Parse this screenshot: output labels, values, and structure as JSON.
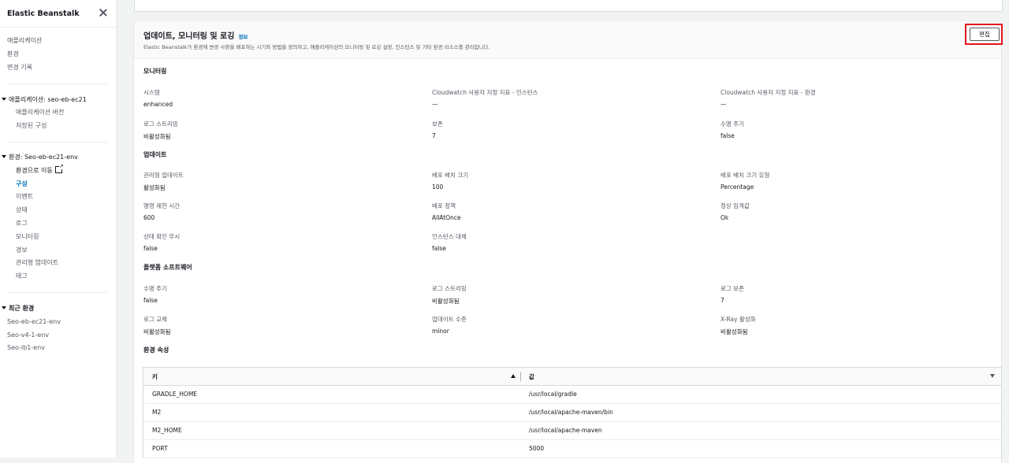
{
  "sidebar": {
    "title": "Elastic Beanstalk",
    "top_links": [
      "애플리케이션",
      "환경",
      "변경 기록"
    ],
    "app_section": "애플리케이션: seo-eb-ec21",
    "app_links": [
      "애플리케이션 버전",
      "저장된 구성"
    ],
    "env_section": "환경: Seo-eb-ec21-env",
    "env_links": [
      "환경으로 이동",
      "구성",
      "이벤트",
      "상태",
      "로그",
      "모니터링",
      "경보",
      "관리형 업데이트",
      "태그"
    ],
    "recent_section": "최근 환경",
    "recent_links": [
      "Seo-eb-ec21-env",
      "Seo-v4-1-env",
      "Seo-lb1-env"
    ]
  },
  "panel": {
    "title": "업데이트, 모니터링 및 로깅",
    "info": "정보",
    "description": "Elastic Beanstalk가 환경에 변경 사항을 배포하는 시기와 방법을 정의하고, 애플리케이션의 모니터링 및 로깅 설정, 인스턴스 및 기타 환경 리소스를 관리합니다.",
    "edit_button": "편집"
  },
  "monitoring": {
    "heading": "모니터링",
    "system_label": "시스템",
    "system_value": "enhanced",
    "cw_instance_label": "Cloudwatch 사용자 지정 지표 - 인스턴스",
    "cw_instance_value": "—",
    "cw_env_label": "Cloudwatch 사용자 지정 지표 - 환경",
    "cw_env_value": "—",
    "log_stream_label": "로그 스트리밍",
    "log_stream_value": "비활성화됨",
    "retention_label": "보존",
    "retention_value": "7",
    "lifecycle_label": "수명 주기",
    "lifecycle_value": "false"
  },
  "updates": {
    "heading": "업데이트",
    "managed_label": "관리형 업데이트",
    "managed_value": "활성화됨",
    "batch_size_label": "배포 배치 크기",
    "batch_size_value": "100",
    "batch_type_label": "배포 배치 크기 유형",
    "batch_type_value": "Percentage",
    "timeout_label": "명령 제한 시간",
    "timeout_value": "600",
    "policy_label": "배포 정책",
    "policy_value": "AllAtOnce",
    "threshold_label": "정상 임계값",
    "threshold_value": "Ok",
    "ignore_health_label": "상태 확인 무시",
    "ignore_health_value": "false",
    "replace_label": "인스턴스 대체",
    "replace_value": "false"
  },
  "platform": {
    "heading": "플랫폼 소프트웨어",
    "lifecycle_label": "수명 주기",
    "lifecycle_value": "false",
    "log_stream_label": "로그 스트리밍",
    "log_stream_value": "비활성화됨",
    "log_retention_label": "로그 보존",
    "log_retention_value": "7",
    "log_rotation_label": "로그 교체",
    "log_rotation_value": "비활성화됨",
    "update_level_label": "업데이트 수준",
    "update_level_value": "minor",
    "xray_label": "X-Ray 활성화",
    "xray_value": "비활성화됨"
  },
  "env_props": {
    "heading": "환경 속성",
    "col_key": "키",
    "col_value": "값",
    "rows": [
      {
        "key": "GRADLE_HOME",
        "value": "/usr/local/gradle"
      },
      {
        "key": "M2",
        "value": "/usr/local/apache-maven/bin"
      },
      {
        "key": "M2_HOME",
        "value": "/usr/local/apache-maven"
      },
      {
        "key": "PORT",
        "value": "5000"
      }
    ]
  }
}
